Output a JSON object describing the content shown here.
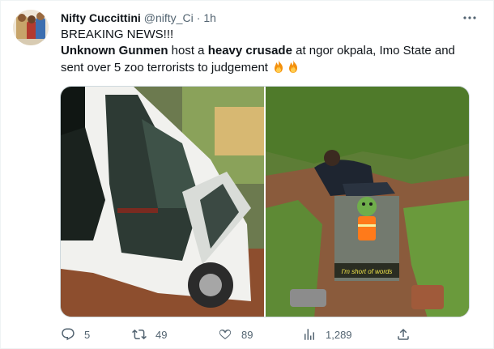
{
  "tweet": {
    "author_name": "Nifty Cuccittini",
    "handle": "@nifty_Ci",
    "separator": "·",
    "time": "1h",
    "line1": "BREAKING NEWS!!!",
    "line2_part1": "Unknown Gunmen",
    "line2_part2": " host a ",
    "line2_part3": "heavy crusade",
    "line2_part4": " at ngor okpala, Imo State and",
    "line3": "sent over 5 zoo terrorists to judgement "
  },
  "media": {
    "left_image": "white pickup truck with open doors",
    "right_image": "man lying in grass with sticker overlay",
    "sticker_text": "I'm short of words"
  },
  "actions": {
    "replies": "5",
    "retweets": "49",
    "likes": "89",
    "views": "1,289"
  },
  "colors": {
    "text": "#0f1419",
    "secondary": "#536471",
    "border": "#cfd9de"
  },
  "icons": [
    "more-icon",
    "reply-icon",
    "retweet-icon",
    "like-icon",
    "views-icon",
    "share-icon",
    "fire-emoji"
  ]
}
